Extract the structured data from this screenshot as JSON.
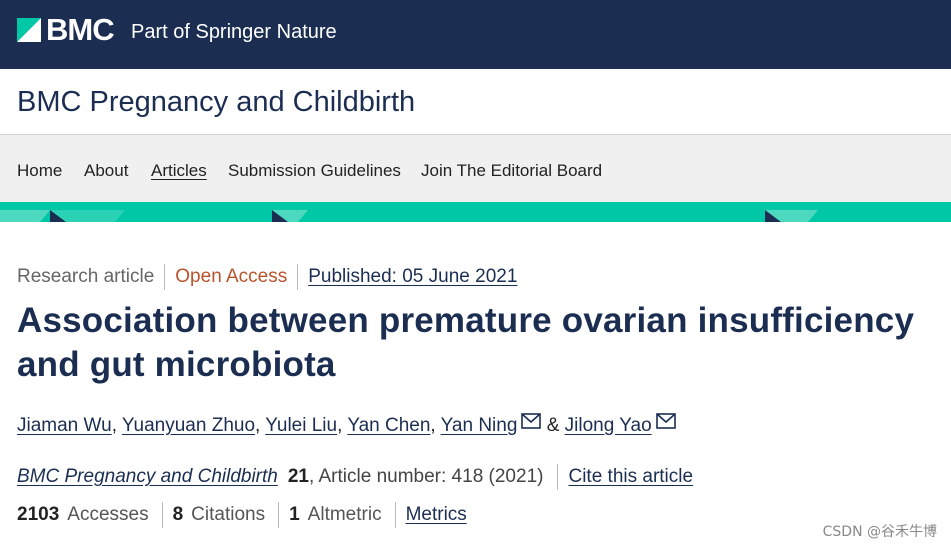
{
  "brand": {
    "logo_icon": "bmc-logo-icon",
    "name": "BMC",
    "tagline": "Part of Springer Nature"
  },
  "journal": {
    "title": "BMC Pregnancy and Childbirth"
  },
  "nav": {
    "items": [
      {
        "label": "Home",
        "active": false
      },
      {
        "label": "About",
        "active": false
      },
      {
        "label": "Articles",
        "active": true
      },
      {
        "label": "Submission Guidelines",
        "active": false
      },
      {
        "label": "Join The Editorial Board",
        "active": false
      }
    ]
  },
  "article": {
    "type": "Research article",
    "access": "Open Access",
    "published": "Published: 05 June 2021",
    "title": "Association between premature ovarian insufficiency and gut microbiota",
    "authors": [
      "Jiaman Wu",
      "Yuanyuan Zhuo",
      "Yulei Liu",
      "Yan Chen",
      "Yan Ning",
      "Jilong Yao"
    ],
    "author_separator": ",",
    "author_conjunction": "&",
    "citation": {
      "journal": "BMC Pregnancy and Childbirth",
      "volume": "21",
      "article_number": ", Article number: 418 (2021)",
      "cite_link": "Cite this article"
    },
    "metrics": {
      "accesses_count": "2103",
      "accesses_label": "Accesses",
      "citations_count": "8",
      "citations_label": "Citations",
      "altmetric_count": "1",
      "altmetric_label": "Altmetric",
      "metrics_link": "Metrics"
    }
  },
  "watermark": "CSDN @谷禾牛博",
  "colors": {
    "header_bg": "#1b2e52",
    "accent_teal": "#00c8a7",
    "open_access": "#b7542e",
    "link": "#1b2e52"
  }
}
